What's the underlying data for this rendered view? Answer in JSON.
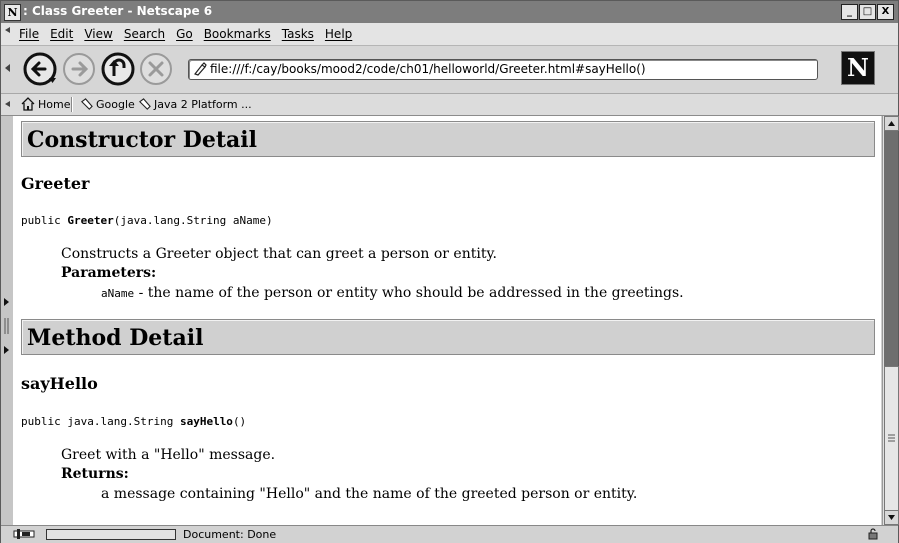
{
  "window": {
    "title": ": Class Greeter - Netscape 6",
    "app_icon_letter": "N",
    "controls": {
      "minimize": "_",
      "maximize": "□",
      "close": "X"
    }
  },
  "menu": [
    "File",
    "Edit",
    "View",
    "Search",
    "Go",
    "Bookmarks",
    "Tasks",
    "Help"
  ],
  "navigation": {
    "buttons": [
      "back-icon",
      "forward-icon",
      "reload-icon",
      "stop-icon"
    ],
    "url": "file:///f:/cay/books/mood2/code/ch01/helloworld/Greeter.html#sayHello()",
    "logo_letter": "N"
  },
  "personal_toolbar": [
    "Home",
    "Google",
    "Java 2 Platform ..."
  ],
  "page": {
    "constructor_detail": {
      "heading": "Constructor Detail",
      "name": "Greeter",
      "signature_prefix": "public ",
      "signature_name": "Greeter",
      "signature_suffix": "(java.lang.String aName)",
      "description": "Constructs a Greeter object that can greet a person or entity.",
      "params_label": "Parameters:",
      "param_name": "aName",
      "param_desc": " - the name of the person or entity who should be addressed in the greetings."
    },
    "method_detail": {
      "heading": "Method Detail",
      "name": "sayHello",
      "signature_prefix": "public java.lang.String ",
      "signature_name": "sayHello",
      "signature_suffix": "()",
      "description": "Greet with a \"Hello\" message.",
      "returns_label": "Returns:",
      "returns_desc": "a message containing \"Hello\" and the name of the greeted person or entity."
    }
  },
  "status": {
    "text": "Document: Done"
  },
  "colors": {
    "titlebar": "#7d7d7d",
    "section_bar": "#d0d0d0",
    "content_bg": "#ffffff"
  }
}
